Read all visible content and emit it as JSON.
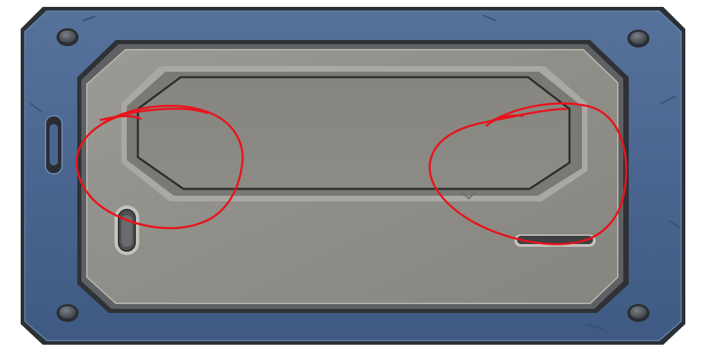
{
  "panel": {
    "frame_color": "#4a6690",
    "frame_edge_color": "#2e3338",
    "plate_color": "#8e8d87",
    "recess_color": "#85847f",
    "annotation_color": "#e8141c"
  },
  "icons": {
    "screw": "screw-icon",
    "slot": "slot-icon"
  },
  "annotations": [
    {
      "shape": "ellipse",
      "label": ""
    },
    {
      "shape": "ellipse",
      "label": ""
    }
  ]
}
